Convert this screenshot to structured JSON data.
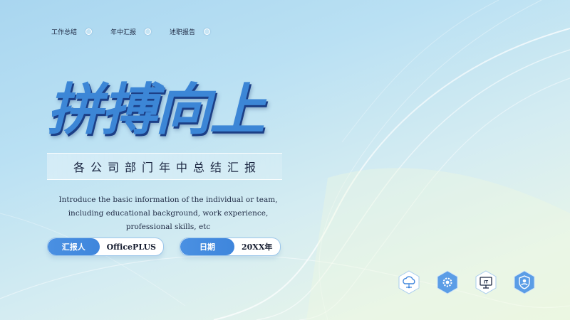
{
  "nav": {
    "items": [
      {
        "label": "工作总结"
      },
      {
        "label": "年中汇报"
      },
      {
        "label": "述职报告"
      }
    ]
  },
  "title": "拼搏向上",
  "subtitle": "各公司部门年中总结汇报",
  "intro": "Introduce the basic information of the individual or team, including educational background, work experience, professional skills, etc",
  "reporter": {
    "label": "汇报人",
    "value": "OfficePLUS"
  },
  "date": {
    "label": "日期",
    "value": "20XX年"
  },
  "icons": [
    {
      "name": "cloud-network-icon"
    },
    {
      "name": "settings-gear-icon"
    },
    {
      "name": "it-monitor-icon",
      "text": "IT"
    },
    {
      "name": "user-shield-icon"
    }
  ],
  "colors": {
    "accent": "#4a90e2",
    "title": "#3c86d6",
    "title_shadow": "#1c3f86",
    "text": "#1f2a44"
  }
}
